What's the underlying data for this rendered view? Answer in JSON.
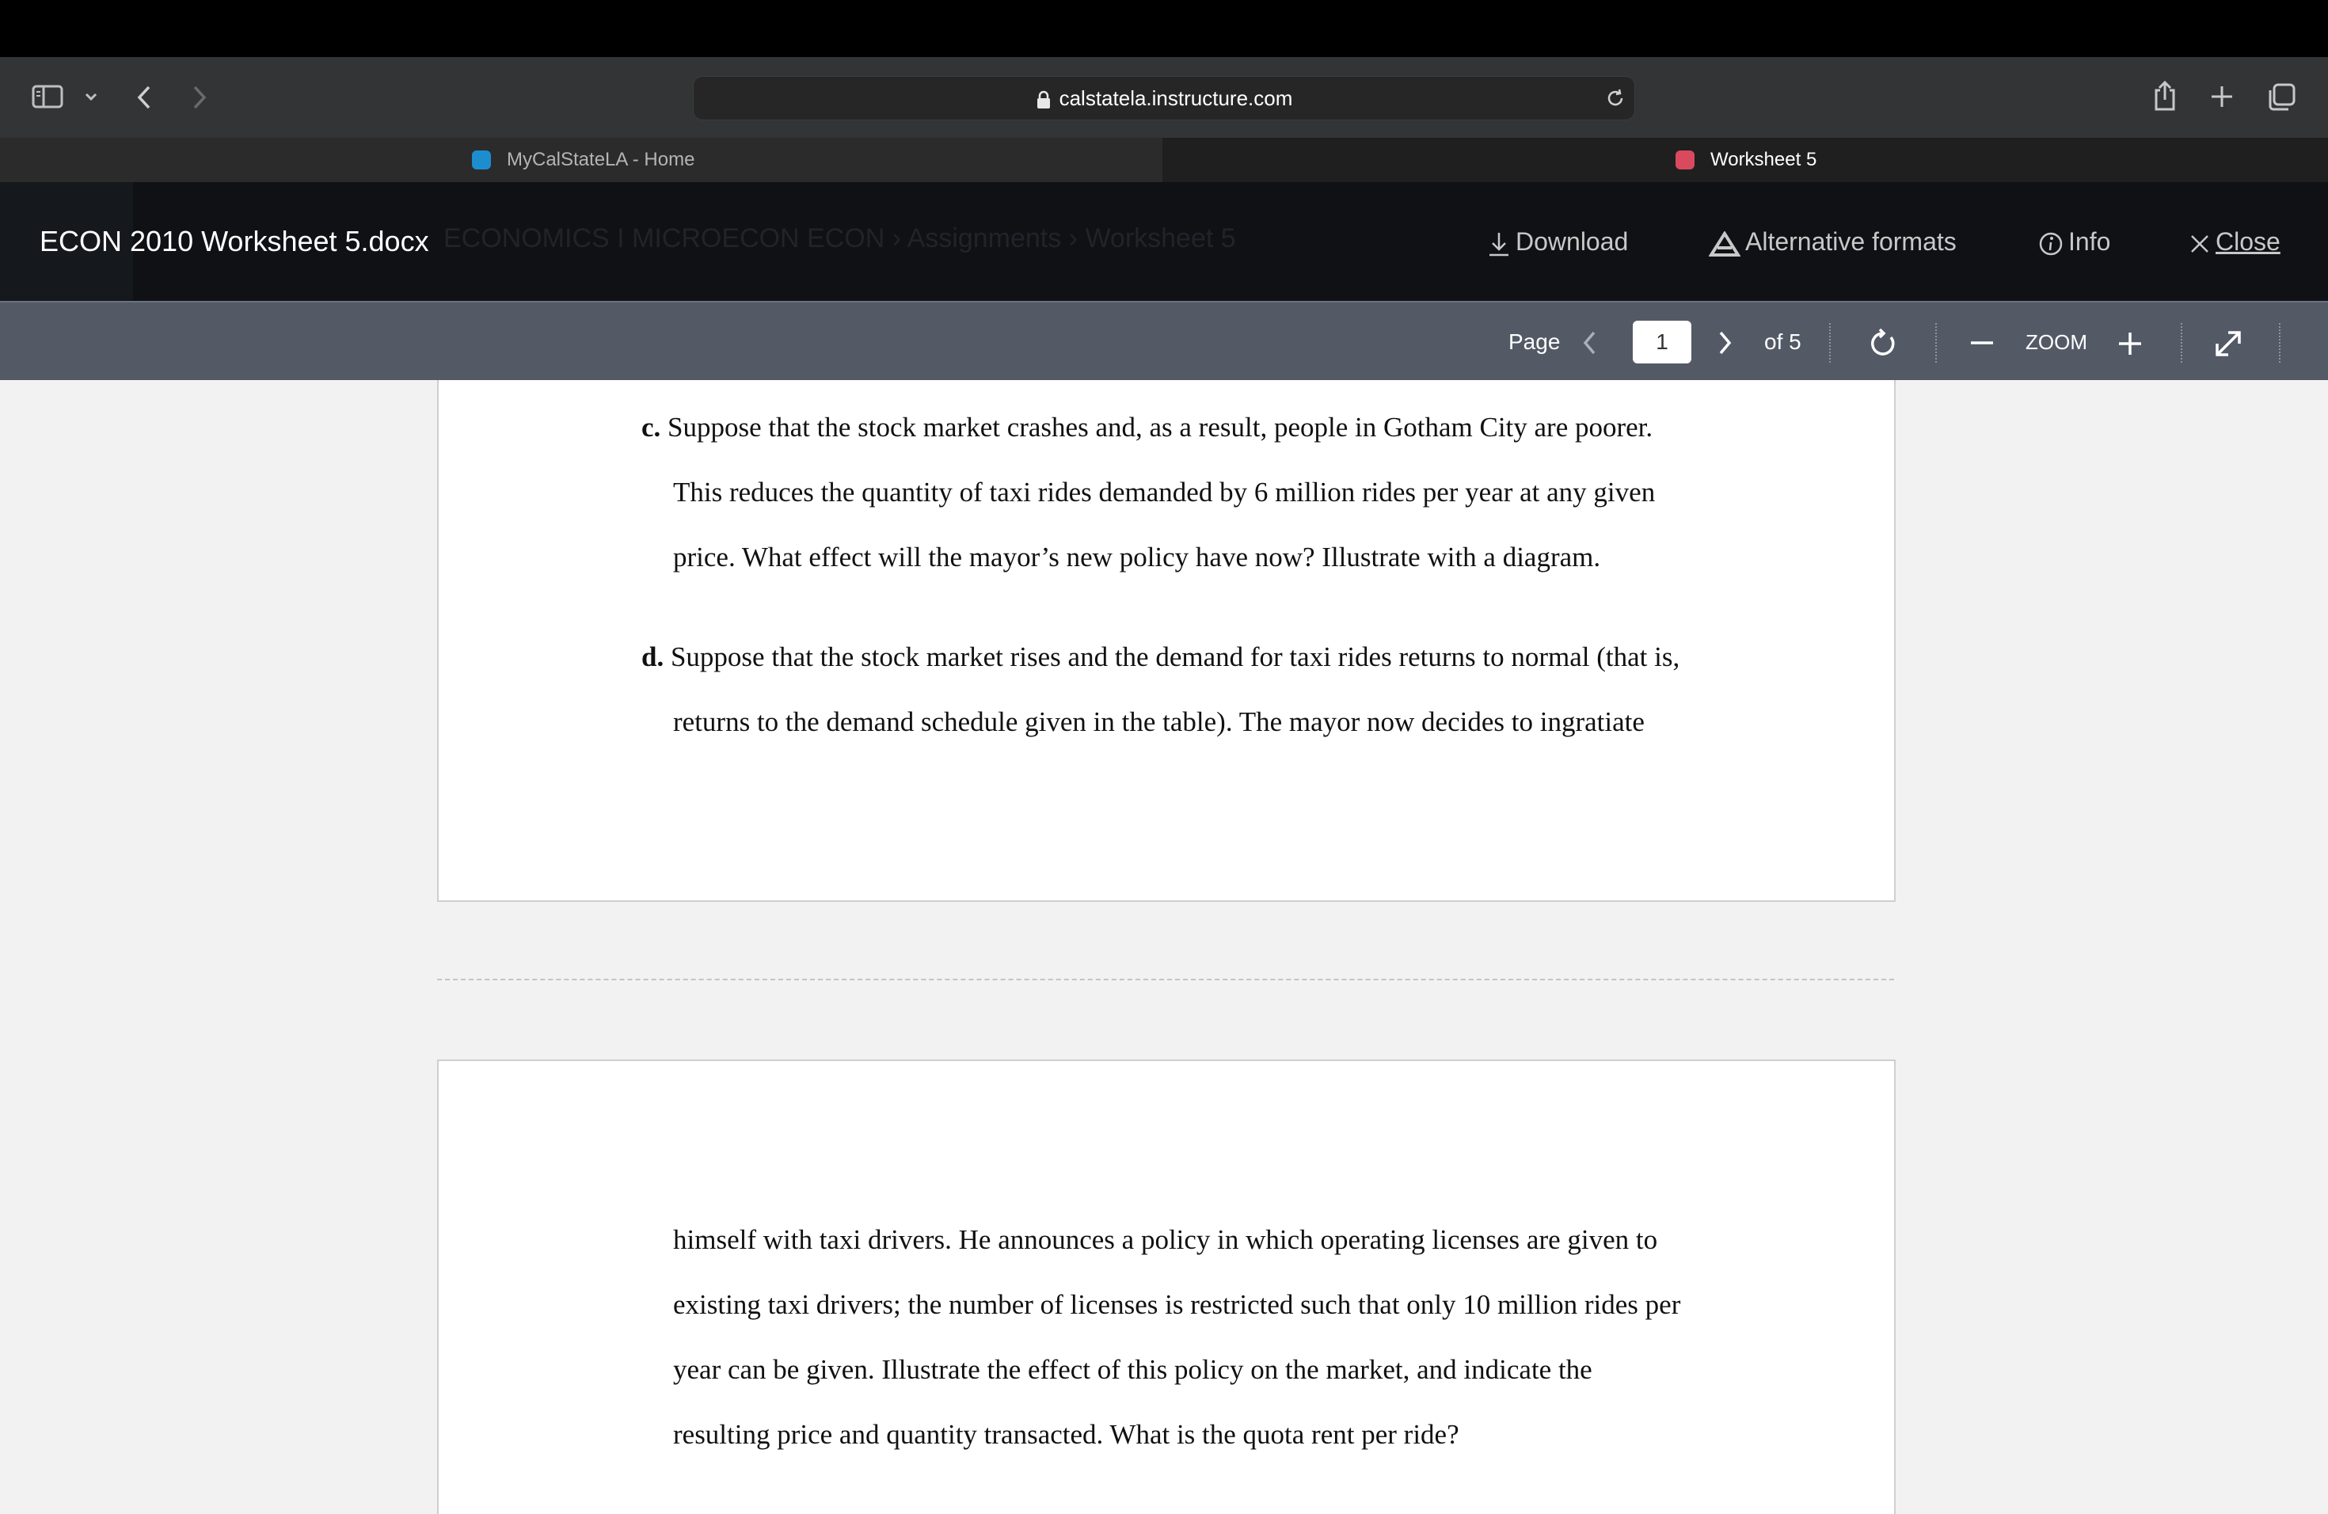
{
  "browser": {
    "address": "calstatela.instructure.com",
    "tabs": [
      {
        "label": "MyCalStateLA - Home",
        "active": false
      },
      {
        "label": "Worksheet 5",
        "active": true
      }
    ]
  },
  "header": {
    "title": "ECON 2010 Worksheet 5.docx",
    "ghost_breadcrumb": "ECONOMICS I MICROECON ECON  ›  Assignments  ›  Worksheet 5",
    "download": "Download",
    "alt_formats": "Alternative formats",
    "info": "Info",
    "close": "Close"
  },
  "preview_toolbar": {
    "page_label": "Page",
    "current_page": "1",
    "of_pages": "of 5",
    "zoom_label": "ZOOM"
  },
  "document": {
    "page1": {
      "c_marker": "c.",
      "c_line1": "Suppose that the stock market crashes and, as a result, people in Gotham City are poorer.",
      "c_line2": "This reduces the quantity of taxi rides demanded by 6 million rides per year at any given",
      "c_line3": "price. What effect will the mayor’s new policy have now? Illustrate with a diagram.",
      "d_marker": "d.",
      "d_line1": "Suppose that the stock market rises and the demand for taxi rides returns to normal (that is,",
      "d_line2": "returns to the demand schedule given in the table). The mayor now decides to ingratiate"
    },
    "page2": {
      "line1": "himself with taxi drivers. He announces a policy in which operating licenses are given to",
      "line2": "existing taxi drivers; the number of licenses is restricted such that only 10 million rides per",
      "line3": "year can be given. Illustrate the effect of this policy on the market, and indicate the",
      "line4": "resulting price and quantity transacted. What is the quota rent per ride?"
    }
  },
  "colors": {
    "toolbar": "#333436",
    "header": "#0f1114",
    "preview_bar": "#535a66",
    "viewer_bg": "#f2f2f2"
  }
}
